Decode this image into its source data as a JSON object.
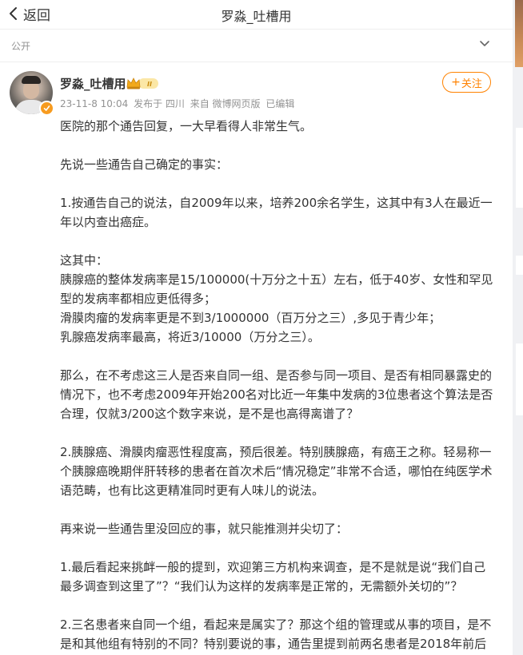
{
  "topbar": {
    "back_label": "返回",
    "title": "罗淼_吐槽用"
  },
  "subbar": {
    "visibility": "公开"
  },
  "author": {
    "name": "罗淼_吐槽用",
    "member_level": "II",
    "date": "23-11-8 10:04",
    "location_text": "发布于 四川",
    "source_text": "来自 微博网页版",
    "edited_text": "已编辑",
    "follow_label": "关注",
    "follow_plus": "+"
  },
  "colors": {
    "accent_orange": "#ff8200",
    "meta_gray": "#939393",
    "text_primary": "#333333",
    "badge_gold": "#f79b1f"
  },
  "icons": {
    "back": "chevron-left-icon",
    "collapse": "chevron-down-icon",
    "membership": "crown-icon",
    "verified": "verified-icon"
  },
  "post": {
    "lines": [
      "医院的那个通告回复，一大早看得人非常生气。",
      "",
      "先说一些通告自己确定的事实：",
      "",
      "1.按通告自己的说法，自2009年以来，培养200余名学生，这其中有3人在最近一",
      "年以内查出癌症。",
      "",
      "这其中：",
      "胰腺癌的整体发病率是15/100000(十万分之十五）左右，低于40岁、女性和罕见",
      "型的发病率都相应更低得多；",
      "滑膜肉瘤的发病率更是不到3/1000000（百万分之三）,多见于青少年；",
      "乳腺癌发病率最高，将近3/10000（万分之三）。",
      "",
      "那么，在不考虑这三人是否来自同一组、是否参与同一项目、是否有相同暴露史的",
      "情况下，也不考虑2009年开始200名对比近一年集中发病的3位患者这个算法是否",
      "合理，仅就3/200这个数字来说，是不是也高得离谱了？",
      "",
      "2.胰腺癌、滑膜肉瘤恶性程度高，预后很差。特别胰腺癌，有癌王之称。轻易称一",
      "个胰腺癌晚期伴肝转移的患者在首次术后“情况稳定”非常不合适，哪怕在纯医学术",
      "语范畴，也有比这更精准同时更有人味儿的说法。",
      "",
      "再来说一些通告里没回应的事，就只能推测并尖切了：",
      "",
      "1.最后看起来挑衅一般的提到，欢迎第三方机构来调查，是不是就是说“我们自己",
      "最多调查到这里了”？“我们认为这样的发病率是正常的，无需额外关切的”？",
      "",
      "2.三名患者来自同一个组，看起来是属实了？那这个组的管理或从事的项目，是不",
      "是和其他组有特别的不同？特别要说的事，通告里提到前两名患者是2018年前后"
    ]
  }
}
